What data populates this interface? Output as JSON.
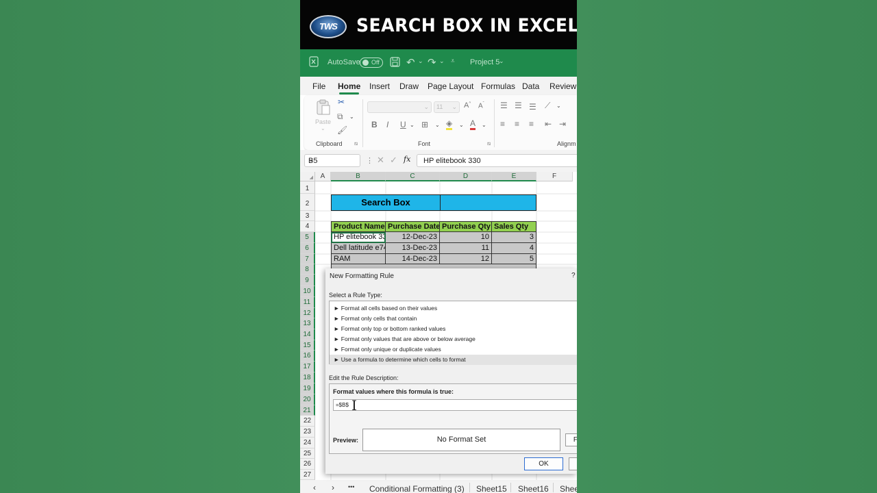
{
  "banner": {
    "logo_text": "TWS",
    "title": "SEARCH BOX IN EXCEL"
  },
  "titlebar": {
    "autosave_label": "AutoSave",
    "autosave_state": "Off",
    "file_name": "Project 5"
  },
  "ribbon_tabs": [
    "File",
    "Home",
    "Insert",
    "Draw",
    "Page Layout",
    "Formulas",
    "Data",
    "Review"
  ],
  "ribbon": {
    "paste_label": "Paste",
    "clipboard_label": "Clipboard",
    "font_size": "11",
    "font_label": "Font",
    "alignment_label": "Alignm",
    "bold": "B",
    "italic": "I",
    "underline": "U"
  },
  "formula_bar": {
    "name_box": "B5",
    "fx": "fx",
    "value": "HP elitebook 330"
  },
  "columns": [
    "A",
    "B",
    "C",
    "D",
    "E",
    "F"
  ],
  "rows": [
    "1",
    "2",
    "3",
    "4",
    "5",
    "6",
    "7",
    "8",
    "9",
    "10",
    "11",
    "12",
    "13",
    "14",
    "15",
    "16",
    "17",
    "18",
    "19",
    "20",
    "21",
    "22",
    "23",
    "24",
    "25",
    "26",
    "27"
  ],
  "search_box_label": "Search Box",
  "table": {
    "headers": [
      "Product Name",
      "Purchase Date",
      "Purchase Qty",
      "Sales Qty"
    ],
    "rows": [
      [
        "HP elitebook 33",
        "12-Dec-23",
        "10",
        "3"
      ],
      [
        "Dell latitude e74",
        "13-Dec-23",
        "11",
        "4"
      ],
      [
        "RAM",
        "14-Dec-23",
        "12",
        "5"
      ]
    ]
  },
  "sheet_tabs": {
    "more": "•••",
    "tabs": [
      "Conditional Formatting (3)",
      "Sheet15",
      "Sheet16",
      "Shee"
    ]
  },
  "dialog": {
    "title": "New Formatting Rule",
    "help": "?",
    "select_rule_label": "Select a Rule Type:",
    "rules": [
      "► Format all cells based on their values",
      "► Format only cells that contain",
      "► Format only top or bottom ranked values",
      "► Format only values that are above or below average",
      "► Format only unique or duplicate values",
      "► Use a formula to determine which cells to format"
    ],
    "edit_rule_label": "Edit the Rule Description:",
    "formula_label": "Format values where this formula is true:",
    "formula_value": "=$B$",
    "preview_label": "Preview:",
    "preview_text": "No Format Set",
    "format_button": "F",
    "ok_button": "OK"
  },
  "colors": {
    "excel_green": "#1f8a4c",
    "header_fill": "#92d050",
    "search_fill": "#1fb5e8",
    "data_fill": "#c8c8c8"
  }
}
